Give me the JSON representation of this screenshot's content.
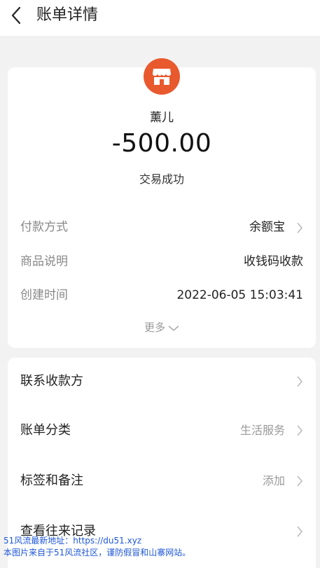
{
  "header": {
    "title": "账单详情"
  },
  "bill": {
    "payee": "薰儿",
    "amount": "-500.00",
    "status": "交易成功"
  },
  "details": [
    {
      "label": "付款方式",
      "value": "余额宝"
    },
    {
      "label": "商品说明",
      "value": "收钱码收款"
    },
    {
      "label": "创建时间",
      "value": "2022-06-05 15:03:41"
    }
  ],
  "more_label": "更多",
  "actions": [
    {
      "label": "联系收款方",
      "value": ""
    },
    {
      "label": "账单分类",
      "value": "生活服务"
    },
    {
      "label": "标签和备注",
      "value": "添加"
    },
    {
      "label": "查看往来记录",
      "value": ""
    }
  ],
  "watermark": {
    "line1": "51风流最新地址：https://du51.xyz",
    "line2": "本图片来自于51风流社区，谨防假冒和山寨网站。"
  },
  "colors": {
    "brand_icon_bg": "#e8592e",
    "watermark": "#1f57d6"
  }
}
